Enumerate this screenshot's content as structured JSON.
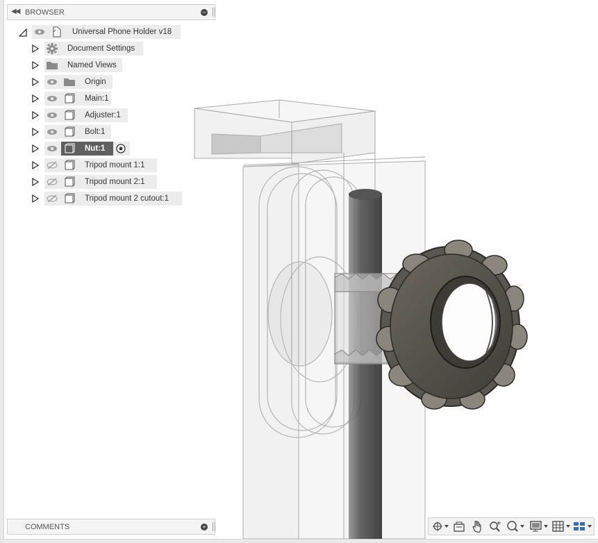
{
  "browser": {
    "title": "BROWSER",
    "collapse_icon": "double-left-arrow-icon",
    "root": {
      "label": "Universal Phone Holder v18",
      "icon": "document-icon"
    },
    "items": [
      {
        "label": "Document Settings",
        "icon": "gear-icon",
        "visible": null
      },
      {
        "label": "Named Views",
        "icon": "folder-icon",
        "visible": null
      },
      {
        "label": "Origin",
        "icon": "folder-icon",
        "visible": true
      },
      {
        "label": "Main:1",
        "icon": "component-icon",
        "visible": true
      },
      {
        "label": "Adjuster:1",
        "icon": "component-icon",
        "visible": true
      },
      {
        "label": "Bolt:1",
        "icon": "component-icon",
        "visible": true
      },
      {
        "label": "Nut:1",
        "icon": "component-icon",
        "visible": true,
        "selected": true,
        "active": true
      },
      {
        "label": "Tripod mount 1:1",
        "icon": "component-icon",
        "visible": false
      },
      {
        "label": "Tripod mount 2:1",
        "icon": "component-icon",
        "visible": false
      },
      {
        "label": "Tripod mount 2 cutout:1",
        "icon": "component-icon",
        "visible": false
      }
    ]
  },
  "comments": {
    "title": "COMMENTS"
  },
  "navbar": {
    "tools": [
      "orbit-icon",
      "look-at-icon",
      "pan-icon",
      "zoom-icon",
      "zoom-window-icon",
      "display-settings-icon",
      "grid-icon",
      "viewports-icon"
    ]
  },
  "colors": {
    "selection": "#5f5f5f",
    "label_bg": "#ececec",
    "nut": "#7a7668"
  }
}
